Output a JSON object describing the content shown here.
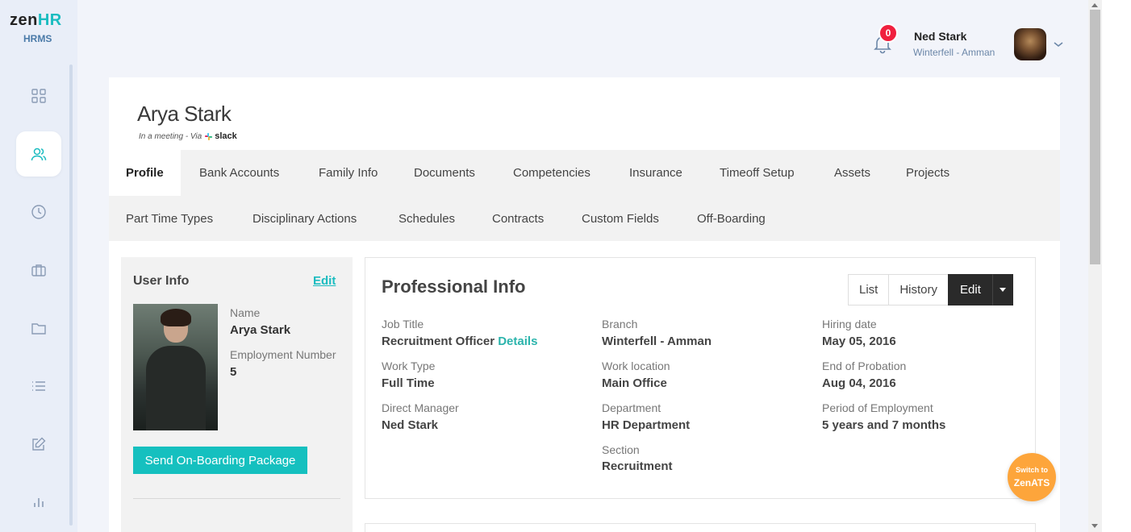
{
  "app": {
    "brand_main": "zen",
    "brand_accent": "HR",
    "brand_sub": "HRMS",
    "accent_color": "#1bbcc0"
  },
  "sidebar": {
    "items": [
      {
        "icon": "dashboard-grid-icon",
        "active": false
      },
      {
        "icon": "people-icon",
        "active": true
      },
      {
        "icon": "clock-icon",
        "active": false
      },
      {
        "icon": "briefcase-icon",
        "active": false
      },
      {
        "icon": "folder-icon",
        "active": false
      },
      {
        "icon": "list-icon",
        "active": false
      },
      {
        "icon": "edit-icon",
        "active": false
      },
      {
        "icon": "bar-chart-icon",
        "active": false
      }
    ]
  },
  "header": {
    "notifications_count": "0",
    "user_name": "Ned Stark",
    "user_location": "Winterfell - Amman"
  },
  "employee": {
    "name": "Arya Stark",
    "status_text": "In a meeting - Via",
    "status_app": "slack"
  },
  "tabs": {
    "row1": [
      "Profile",
      "Bank Accounts",
      "Family Info",
      "Documents",
      "Competencies",
      "Insurance",
      "Timeoff Setup",
      "Assets",
      "Projects"
    ],
    "row2": [
      "Part Time Types",
      "Disciplinary Actions",
      "Schedules",
      "Contracts",
      "Custom Fields",
      "Off-Boarding"
    ],
    "active": "Profile"
  },
  "user_info": {
    "title": "User Info",
    "edit_label": "Edit",
    "name_label": "Name",
    "name_value": "Arya Stark",
    "emp_num_label": "Employment Number",
    "emp_num_value": "5",
    "onboard_button": "Send On-Boarding Package"
  },
  "professional_info": {
    "title": "Professional Info",
    "buttons": {
      "list": "List",
      "history": "History",
      "edit": "Edit"
    },
    "fields": {
      "job_title_label": "Job Title",
      "job_title_value": "Recruitment Officer",
      "job_title_link": "Details",
      "work_type_label": "Work Type",
      "work_type_value": "Full Time",
      "direct_manager_label": "Direct Manager",
      "direct_manager_value": "Ned Stark",
      "branch_label": "Branch",
      "branch_value": "Winterfell - Amman",
      "work_location_label": "Work location",
      "work_location_value": "Main Office",
      "department_label": "Department",
      "department_value": "HR Department",
      "section_label": "Section",
      "section_value": "Recruitment",
      "hiring_date_label": "Hiring date",
      "hiring_date_value": "May 05, 2016",
      "end_probation_label": "End of Probation",
      "end_probation_value": "Aug 04, 2016",
      "period_label": "Period of Employment",
      "period_value": "5 years and 7 months"
    }
  },
  "zenats": {
    "line1": "Switch to",
    "line2": "ZenATS",
    "color": "#fda53b"
  }
}
